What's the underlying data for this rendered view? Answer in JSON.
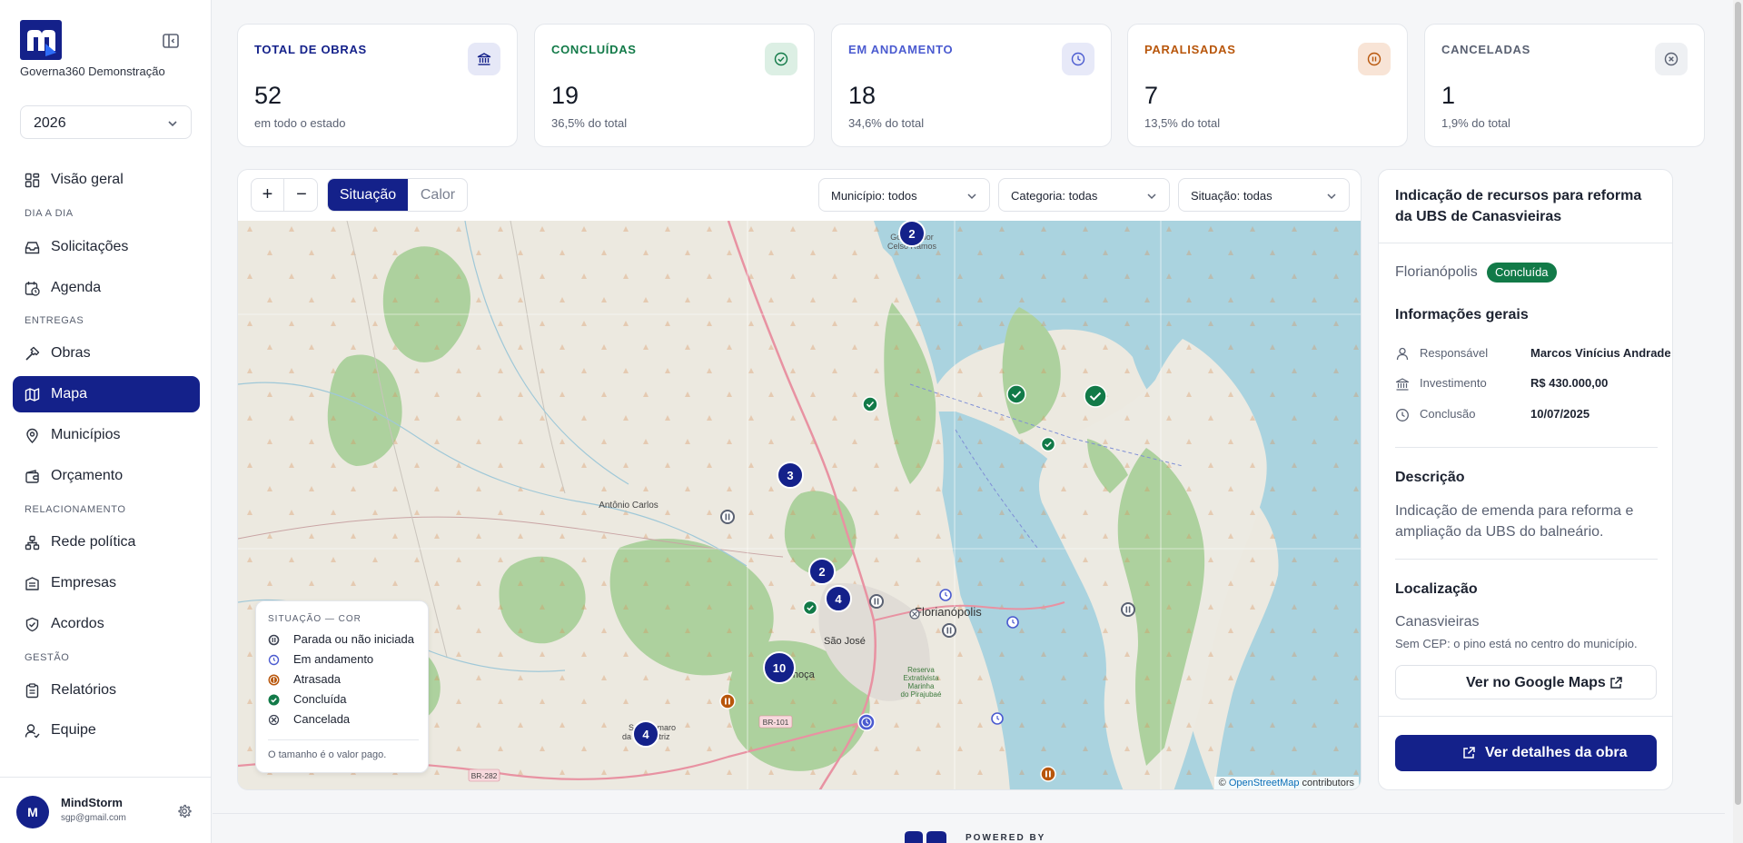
{
  "sidebar": {
    "org_name": "Governa360 Demonstração",
    "year": "2026",
    "sections": {
      "dia_a_dia": "DIA A DIA",
      "entregas": "ENTREGAS",
      "relacionamento": "RELACIONAMENTO",
      "gestao": "GESTÃO"
    },
    "items": {
      "visao_geral": "Visão geral",
      "solicitacoes": "Solicitações",
      "agenda": "Agenda",
      "obras": "Obras",
      "mapa": "Mapa",
      "municipios": "Municípios",
      "orcamento": "Orçamento",
      "rede_politica": "Rede política",
      "empresas": "Empresas",
      "acordos": "Acordos",
      "relatorios": "Relatórios",
      "equipe": "Equipe"
    },
    "active_item": "Mapa",
    "user": {
      "initial": "M",
      "name": "MindStorm",
      "email": "sgp@gmail.com"
    }
  },
  "stats": [
    {
      "title": "TOTAL DE OBRAS",
      "value": "52",
      "sub": "em todo o estado",
      "color": "#14218a",
      "icon": "bank-icon"
    },
    {
      "title": "CONCLUÍDAS",
      "value": "19",
      "sub": "36,5% do total",
      "color": "#127a48",
      "icon": "check-circle-icon"
    },
    {
      "title": "EM ANDAMENTO",
      "value": "18",
      "sub": "34,6% do total",
      "color": "#4b5bd0",
      "icon": "clock-icon"
    },
    {
      "title": "PARALISADAS",
      "value": "7",
      "sub": "13,5% do total",
      "color": "#b8560b",
      "icon": "pause-circle-icon"
    },
    {
      "title": "CANCELADAS",
      "value": "1",
      "sub": "1,9% do total",
      "color": "#5a6172",
      "icon": "x-circle-icon"
    }
  ],
  "map": {
    "zoom_in": "+",
    "zoom_out": "−",
    "mode_situacao": "Situação",
    "mode_calor": "Calor",
    "filters": {
      "municipio": "Município: todos",
      "categoria": "Categoria: todas",
      "situacao": "Situação: todas"
    },
    "place_labels": {
      "governador_celso_ramos_1": "Governador",
      "governador_celso_ramos_2": "Celso Ramos",
      "antonio_carlos": "Antônio Carlos",
      "florianopolis": "Florianópolis",
      "sao_jose": "São José",
      "palhoca": "Palhoça",
      "santo_amaro_1": "Santo Amaro",
      "santo_amaro_2": "da Imperatriz",
      "reserva_1": "Reserva",
      "reserva_2": "Extrativista",
      "reserva_3": "Marinha",
      "reserva_4": "do Pirajubaé",
      "br101": "BR-101",
      "br282": "BR-282"
    },
    "clusters": [
      "2",
      "3",
      "2",
      "4",
      "10",
      "4"
    ],
    "attribution_prefix": "© ",
    "attribution_link": "OpenStreetMap",
    "attribution_suffix": " contributors",
    "legend": {
      "title": "SITUAÇÃO — COR",
      "items": [
        {
          "label": "Parada ou não iniciada",
          "color": "#5a6172"
        },
        {
          "label": "Em andamento",
          "color": "#4b5bd0"
        },
        {
          "label": "Atrasada",
          "color": "#b8560b"
        },
        {
          "label": "Concluída",
          "color": "#127a48"
        },
        {
          "label": "Cancelada",
          "color": "#5a6172"
        }
      ],
      "note": "O tamanho é o valor pago."
    }
  },
  "detail": {
    "title": "Indicação de recursos para reforma da UBS de Canasvieiras",
    "city": "Florianópolis",
    "status": "Concluída",
    "info_heading": "Informações gerais",
    "responsavel_label": "Responsável",
    "responsavel_value": "Marcos Vinícius Andrade",
    "investimento_label": "Investimento",
    "investimento_value": "R$ 430.000,00",
    "conclusao_label": "Conclusão",
    "conclusao_value": "10/07/2025",
    "descricao_heading": "Descrição",
    "descricao_text": "Indicação de emenda para reforma e ampliação da UBS do balneário.",
    "localizacao_heading": "Localização",
    "localizacao_value": "Canasvieiras",
    "localizacao_note": "Sem CEP: o pino está no centro do município.",
    "gmaps_button": "Ver no Google Maps",
    "details_button": "Ver detalhes da obra"
  },
  "footer": {
    "powered_by": "POWERED BY"
  }
}
